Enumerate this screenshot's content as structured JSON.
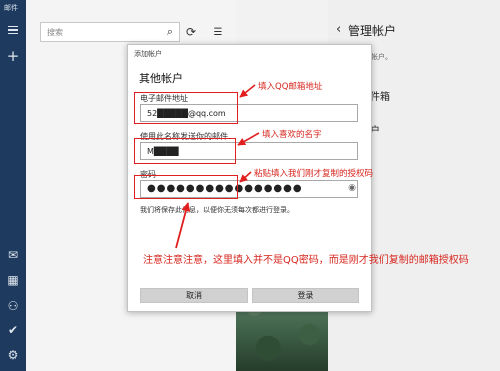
{
  "rail": {
    "title": "邮件",
    "icons": [
      "hamburger-icon",
      "plus-icon",
      "mail-icon",
      "calendar-icon",
      "people-icon",
      "todo-icon",
      "settings-icon"
    ]
  },
  "list_pane": {
    "search_placeholder": "搜索"
  },
  "right_pane": {
    "title": "管理帐户",
    "subtitle": "设置的帐户。",
    "item1": "接收件箱",
    "item2": "加帐户"
  },
  "dialog": {
    "caption": "添加帐户",
    "heading": "其他帐户",
    "email_label": "电子邮件地址",
    "email_value": "52█████@qq.com",
    "name_label": "使用此名称发送你的邮件",
    "name_value": "M████",
    "password_label": "密码",
    "password_dots": "●●●●●●●●●●●●●●●●",
    "note": "我们将保存此信息，以便你无须每次都进行登录。",
    "cancel_label": "取消",
    "login_label": "登录"
  },
  "annotations": {
    "email_hint": "填入QQ邮箱地址",
    "name_hint": "填入喜欢的名字",
    "password_hint": "粘贴填入我们刚才复制的授权码",
    "warning": "注意注意注意，这里填入并不是QQ密码，而是刚才我们复制的邮箱授权码",
    "accent_color": "#e11f1f"
  }
}
